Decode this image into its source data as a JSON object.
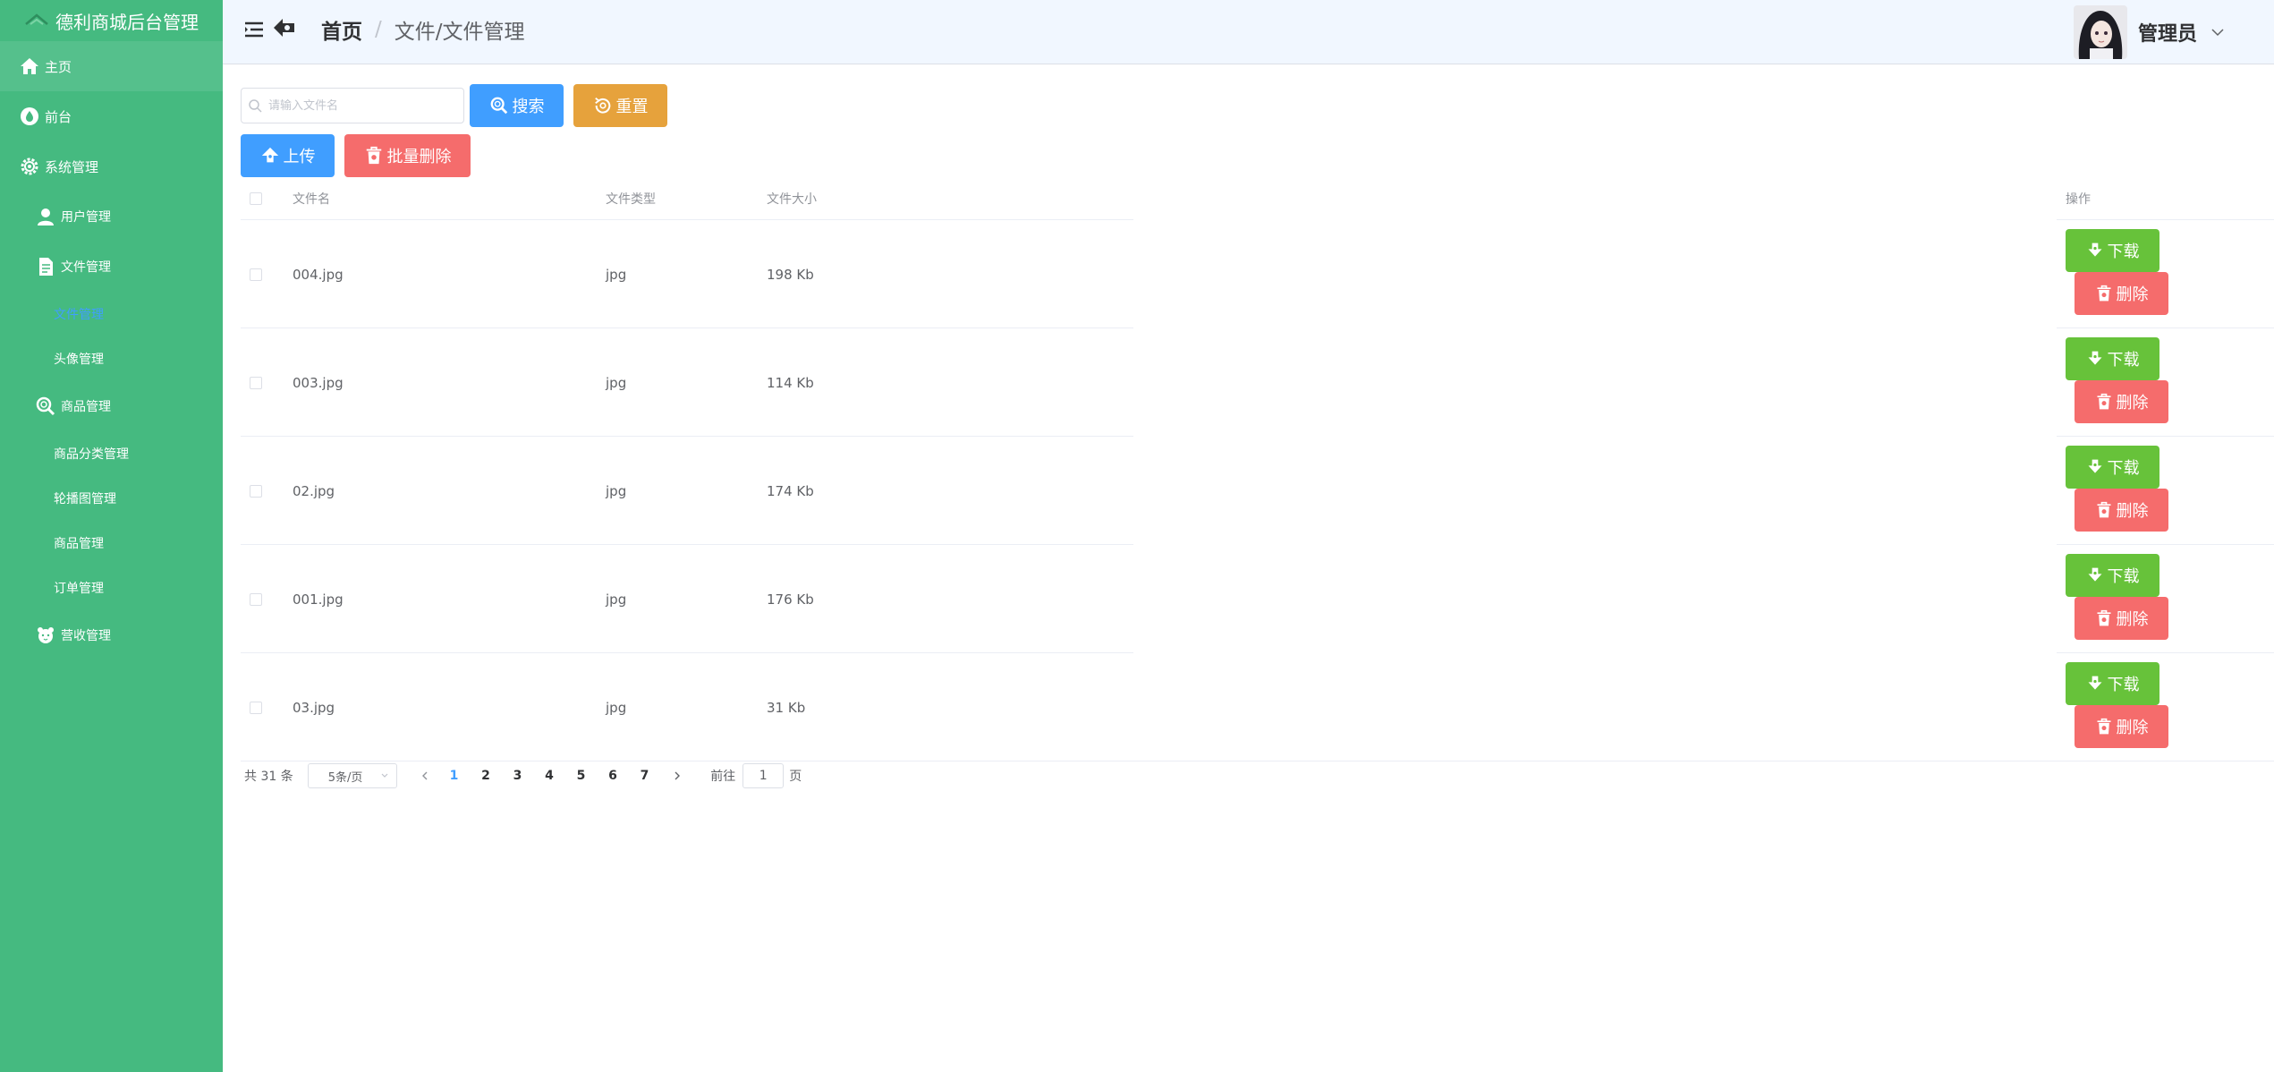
{
  "app": {
    "title": "德利商城后台管理"
  },
  "colors": {
    "sidebar": "#45ba80",
    "primary": "#409eff",
    "warning": "#e6a23c",
    "danger": "#f56c6c",
    "success": "#67c23a"
  },
  "sidebar": {
    "items": [
      {
        "label": "主页",
        "icon": "home-icon"
      },
      {
        "label": "前台",
        "icon": "drop-icon"
      },
      {
        "label": "系统管理",
        "icon": "gear-icon"
      },
      {
        "label": "用户管理",
        "icon": "user-icon"
      },
      {
        "label": "文件管理",
        "icon": "document-icon"
      },
      {
        "label": "文件管理",
        "icon": ""
      },
      {
        "label": "头像管理",
        "icon": ""
      },
      {
        "label": "商品管理",
        "icon": "search-icon"
      },
      {
        "label": "商品分类管理",
        "icon": ""
      },
      {
        "label": "轮播图管理",
        "icon": ""
      },
      {
        "label": "商品管理",
        "icon": ""
      },
      {
        "label": "订单管理",
        "icon": ""
      },
      {
        "label": "营收管理",
        "icon": "bear-icon"
      }
    ]
  },
  "header": {
    "breadcrumb_home": "首页",
    "breadcrumb_sep": "/",
    "breadcrumb_current": "文件/文件管理",
    "user_name": "管理员"
  },
  "toolbar": {
    "search_placeholder": "请输入文件名",
    "search_label": "搜索",
    "reset_label": "重置",
    "upload_label": "上传",
    "batch_delete_label": "批量删除"
  },
  "table": {
    "columns": {
      "name": "文件名",
      "type": "文件类型",
      "size": "文件大小",
      "op": "操作"
    },
    "rows": [
      {
        "name": "004.jpg",
        "type": "jpg",
        "size": "198 Kb"
      },
      {
        "name": "003.jpg",
        "type": "jpg",
        "size": "114 Kb"
      },
      {
        "name": "02.jpg",
        "type": "jpg",
        "size": "174 Kb"
      },
      {
        "name": "001.jpg",
        "type": "jpg",
        "size": "176 Kb"
      },
      {
        "name": "03.jpg",
        "type": "jpg",
        "size": "31 Kb"
      }
    ],
    "download_label": "下载",
    "delete_label": "删除"
  },
  "pagination": {
    "total": "共 31 条",
    "page_size": "5条/页",
    "pages": [
      "1",
      "2",
      "3",
      "4",
      "5",
      "6",
      "7"
    ],
    "current": "1",
    "goto_label": "前往",
    "goto_value": "1",
    "page_unit": "页"
  }
}
